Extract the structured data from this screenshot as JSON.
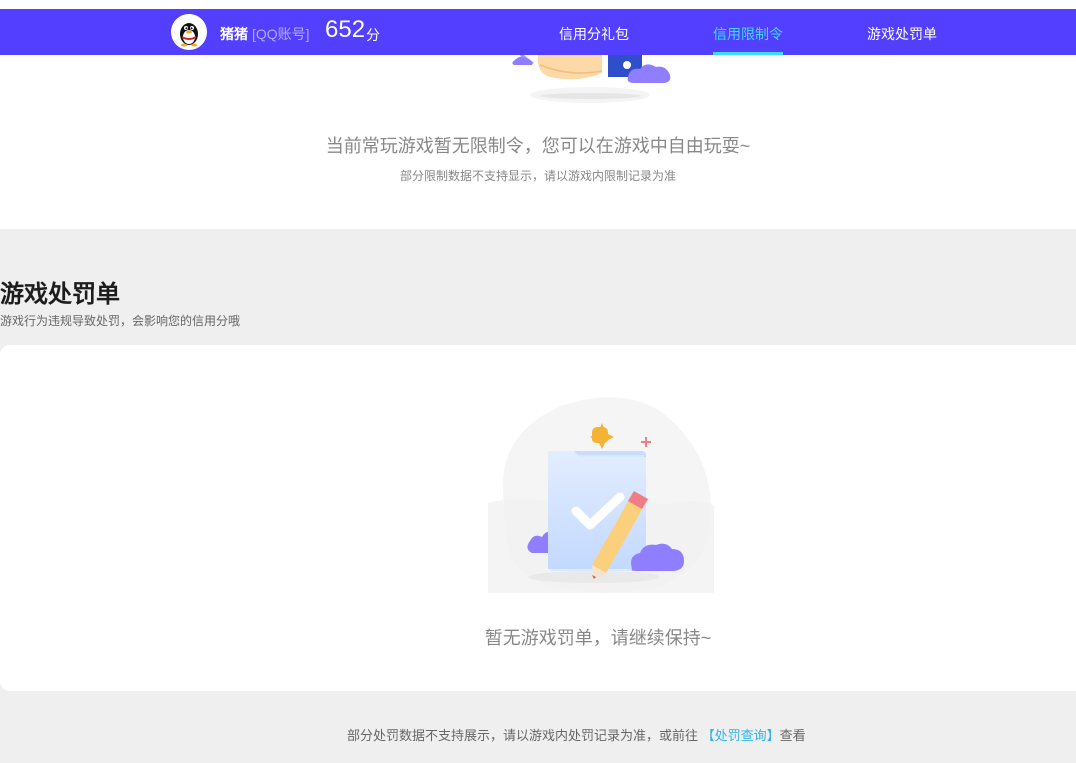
{
  "header": {
    "username": "猪猪",
    "account_type": "[QQ账号]",
    "score": "652",
    "score_unit": "分",
    "tabs": [
      {
        "label": "信用分礼包",
        "active": false
      },
      {
        "label": "信用限制令",
        "active": true
      },
      {
        "label": "游戏处罚单",
        "active": false
      }
    ]
  },
  "restriction_card": {
    "message": "当前常玩游戏暂无限制令，您可以在游戏中自由玩耍~",
    "note": "部分限制数据不支持显示，请以游戏内限制记录为准"
  },
  "penalty_section": {
    "title": "游戏处罚单",
    "subtitle": "游戏行为违规导致处罚，会影响您的信用分哦",
    "empty_message": "暂无游戏罚单，请继续保持~"
  },
  "footer": {
    "note_prefix": "部分处罚数据不支持展示，请以游戏内处罚记录为准，或前往",
    "link_label": "【处罚查询】",
    "note_suffix": "查看"
  },
  "colors": {
    "navbar": "#523fff",
    "active_tab": "#3fdcff",
    "link": "#2eb5ea"
  },
  "icons": {
    "avatar": "qq-penguin-icon",
    "restriction_illustration": "hand-card-icon",
    "penalty_illustration": "clipboard-pencil-check-icon"
  }
}
